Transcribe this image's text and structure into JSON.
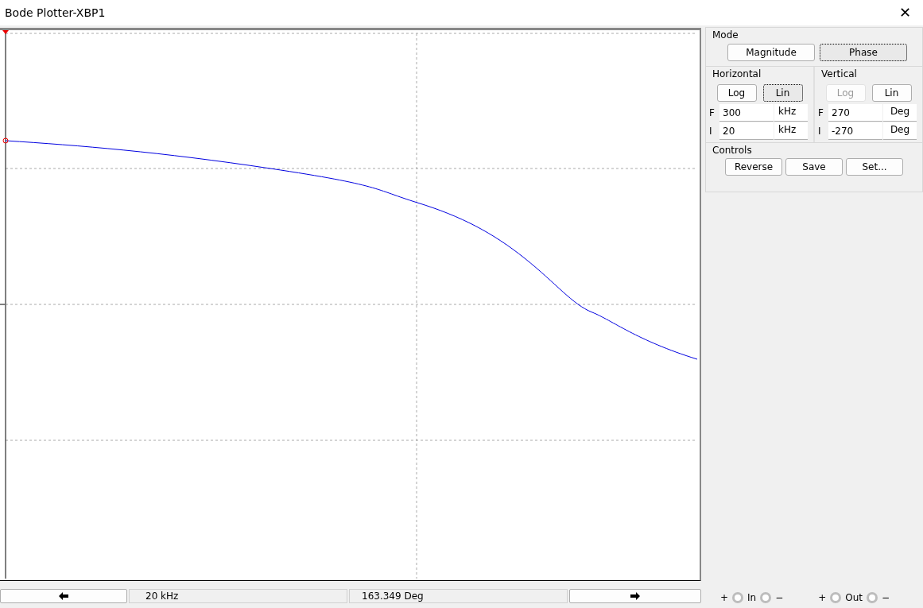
{
  "window": {
    "title": "Bode Plotter-XBP1",
    "close": "✕"
  },
  "mode": {
    "label": "Mode",
    "buttons": [
      {
        "label": "Magnitude",
        "selected": false
      },
      {
        "label": "Phase",
        "selected": true
      }
    ]
  },
  "horizontal": {
    "label": "Horizontal",
    "scale": [
      {
        "label": "Log",
        "selected": false,
        "disabled": false
      },
      {
        "label": "Lin",
        "selected": true,
        "disabled": false
      }
    ],
    "fields": [
      {
        "prefix": "F",
        "value": "300",
        "unit": "kHz"
      },
      {
        "prefix": "I",
        "value": "20",
        "unit": "kHz"
      }
    ]
  },
  "vertical": {
    "label": "Vertical",
    "scale": [
      {
        "label": "Log",
        "selected": false,
        "disabled": true
      },
      {
        "label": "Lin",
        "selected": false,
        "disabled": false
      }
    ],
    "fields": [
      {
        "prefix": "F",
        "value": "270",
        "unit": "Deg"
      },
      {
        "prefix": "I",
        "value": "-270",
        "unit": "Deg"
      }
    ]
  },
  "controls": {
    "label": "Controls",
    "buttons": [
      "Reverse",
      "Save",
      "Set..."
    ]
  },
  "readout": {
    "frequency": "20 kHz",
    "value": "163.349 Deg"
  },
  "terminals": [
    {
      "plus": "+",
      "label": "In",
      "minus": "−"
    },
    {
      "plus": "+",
      "label": "Out",
      "minus": "−"
    }
  ]
}
